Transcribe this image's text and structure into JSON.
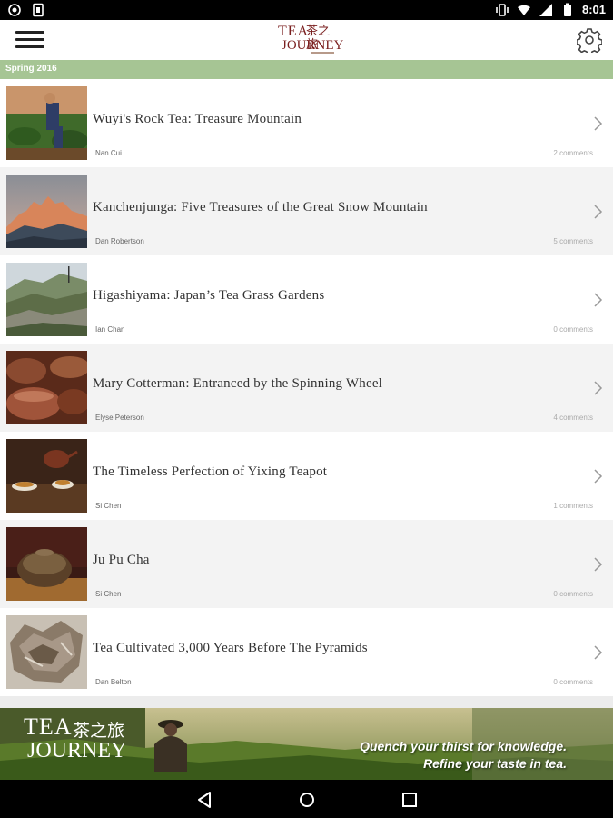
{
  "status": {
    "time": "8:01",
    "icons": [
      "shield-icon",
      "sim-icon",
      "vibrate-icon",
      "wifi-icon",
      "signal-icon",
      "battery-icon"
    ]
  },
  "header": {
    "logo_line1": "TEA",
    "logo_line2": "JOURNEY",
    "logo_cn": "茶之旅",
    "menu_icon": "hamburger-menu-icon",
    "settings_icon": "gear-icon"
  },
  "section": {
    "label": "Spring 2016"
  },
  "articles": [
    {
      "title": "Wuyi's Rock Tea: Treasure Mountain",
      "author": "Nan Cui",
      "comments": "2 comments",
      "thumb": "farmer-in-tea-field"
    },
    {
      "title": "Kanchenjunga: Five Treasures of the Great Snow Mountain",
      "author": "Dan Robertson",
      "comments": "5 comments",
      "thumb": "snow-mountain-peaks"
    },
    {
      "title": "Higashiyama: Japan’s Tea Grass Gardens",
      "author": "Ian Chan",
      "comments": "0 comments",
      "thumb": "hillside-tea-gardens"
    },
    {
      "title": "Mary Cotterman: Entranced by the Spinning Wheel",
      "author": "Elyse Peterson",
      "comments": "4 comments",
      "thumb": "clay-teapots"
    },
    {
      "title": "The Timeless Perfection of Yixing Teapot",
      "author": "Si Chen",
      "comments": "1 comments",
      "thumb": "yixing-teapot-set"
    },
    {
      "title": "Ju Pu Cha",
      "author": "Si Chen",
      "comments": "0 comments",
      "thumb": "pu-erh-in-tangerine"
    },
    {
      "title": "Tea Cultivated 3,000 Years Before The Pyramids",
      "author": "Dan Belton",
      "comments": "0 comments",
      "thumb": "ancient-tea-leaves"
    }
  ],
  "banner": {
    "logo_line1": "TEA",
    "logo_cn": "茶之旅",
    "logo_line2": "JOURNEY",
    "tagline1": "Quench your thirst for knowledge.",
    "tagline2": "Refine your taste in tea."
  },
  "navbar": {
    "icons": [
      "back-icon",
      "home-icon",
      "recents-icon"
    ]
  },
  "colors": {
    "section_bar": "#a6c594",
    "brand": "#7a1f1f",
    "row_alt": "#f3f3f3"
  }
}
